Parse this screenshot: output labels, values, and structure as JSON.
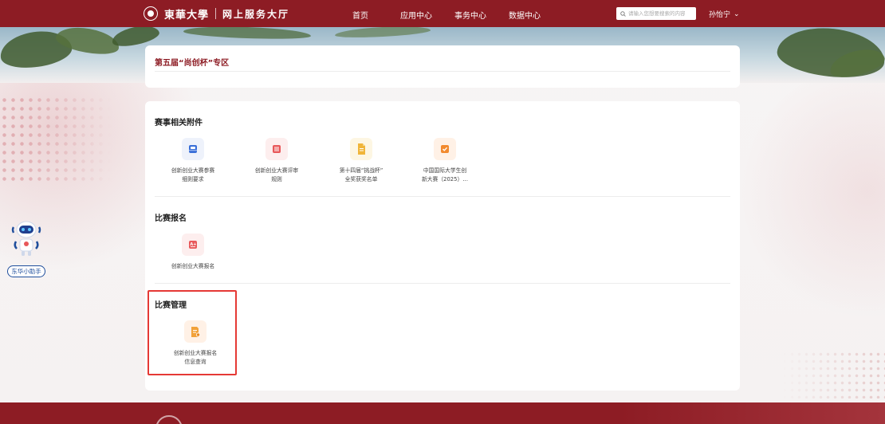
{
  "header": {
    "logo_text": "東華大學",
    "logo_sub": "网上服务大厅",
    "nav": [
      {
        "label": "首页"
      },
      {
        "label": "应用中心"
      },
      {
        "label": "事务中心"
      },
      {
        "label": "数据中心"
      }
    ],
    "search_placeholder": "请输入您想要搜索的内容",
    "user_name": "孙怡宁",
    "user_caret": "⌄"
  },
  "zone": {
    "title": "第五届“尚创杯”专区"
  },
  "sections": [
    {
      "title": "赛事相关附件",
      "items": [
        {
          "label_line1": "创新创业大赛参赛",
          "label_line2": "细则要求",
          "icon": "inbox-icon",
          "icon_bg": "#eef2fb",
          "icon_color": "#3a6fd8"
        },
        {
          "label_line1": "创新创业大赛评审",
          "label_line2": "规则",
          "icon": "list-doc-icon",
          "icon_bg": "#fdeeee",
          "icon_color": "#e8585a"
        },
        {
          "label_line1": "第十四届“挑战杯”",
          "label_line2": "全奖获奖名单",
          "icon": "file-icon",
          "icon_bg": "#fdf6e3",
          "icon_color": "#f0b53a"
        },
        {
          "label_line1": "中国国际大学生创",
          "label_line2": "新大赛（2025）…",
          "icon": "check-doc-icon",
          "icon_bg": "#fff1e6",
          "icon_color": "#f28a2e"
        }
      ]
    },
    {
      "title": "比赛报名",
      "items": [
        {
          "label_line1": "创新创业大赛报名",
          "label_line2": "",
          "icon": "grade-icon",
          "icon_bg": "#fdeeee",
          "icon_color": "#e8585a"
        }
      ]
    },
    {
      "title": "比赛管理",
      "items": [
        {
          "label_line1": "创新创业大赛报名",
          "label_line2": "信息查询",
          "icon": "doc-edit-icon",
          "icon_bg": "#fff1e6",
          "icon_color": "#f2a23a"
        }
      ]
    }
  ],
  "assistant": {
    "label": "东华小助手"
  },
  "colors": {
    "brand": "#8d1c24",
    "highlight": "#e53935"
  }
}
